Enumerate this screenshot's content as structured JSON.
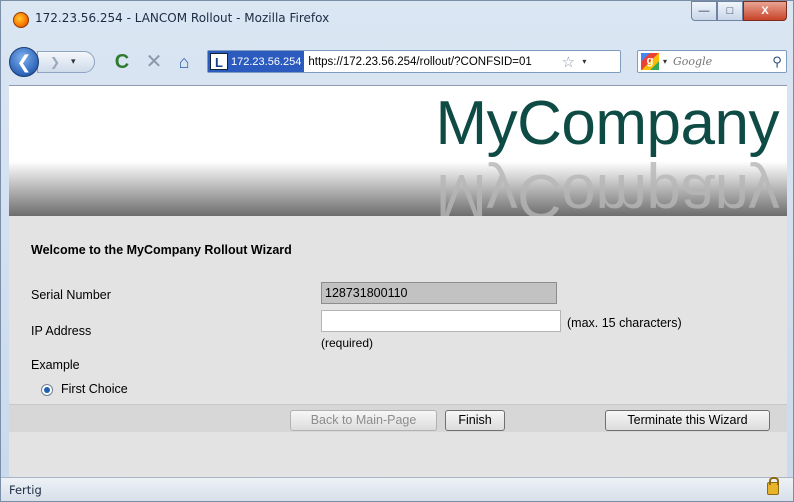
{
  "window": {
    "title": "172.23.56.254 - LANCOM Rollout - Mozilla Firefox",
    "minimize_glyph": "—",
    "maximize_glyph": "□",
    "close_glyph": "X"
  },
  "navbar": {
    "back_glyph": "❮",
    "forward_glyph": "❯",
    "dropdown_glyph": "▾",
    "reload_glyph": "C",
    "stop_glyph": "✕",
    "home_glyph": "⌂",
    "site_identity": "172.23.56.254",
    "site_icon_letter": "L",
    "url": "https://172.23.56.254/rollout/?CONFSID=01",
    "bookmark_glyph": "☆",
    "search_engine_letter": "g",
    "search_placeholder": "Google",
    "search_glyph": "⚲",
    "icons": [
      "back-icon",
      "forward-icon",
      "reload-icon",
      "stop-icon",
      "home-icon",
      "star-icon",
      "search-icon",
      "lock-icon"
    ]
  },
  "page": {
    "brand": "MyCompany",
    "welcome": "Welcome to the MyCompany Rollout Wizard",
    "serial_label": "Serial Number",
    "serial_value": "128731800110",
    "ip_label": "IP Address",
    "ip_value": "",
    "ip_hint": "(max. 15 characters)",
    "ip_required": "(required)",
    "example_label": "Example",
    "radio_option": "First Choice",
    "radio_selected": true,
    "buttons": {
      "back": "Back to Main-Page",
      "finish": "Finish",
      "terminate": "Terminate this Wizard"
    }
  },
  "status": {
    "text": "Fertig"
  },
  "colors": {
    "brand": "#0f4b45",
    "site_badge": "#2c5bbf",
    "close_button": "#c9442a"
  }
}
